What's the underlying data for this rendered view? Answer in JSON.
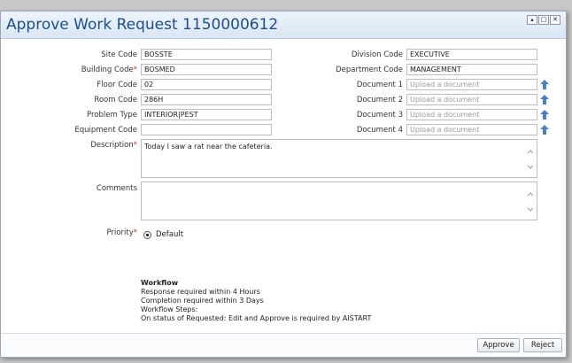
{
  "dialog": {
    "title": "Approve Work Request 1150000612",
    "window_buttons": [
      "▴",
      "□",
      "✕"
    ]
  },
  "fields": {
    "site_code": {
      "label": "Site Code",
      "value": "BOSSTE"
    },
    "building_code": {
      "label": "Building Code",
      "required_mark": "*",
      "value": "BOSMED"
    },
    "floor_code": {
      "label": "Floor Code",
      "value": "02"
    },
    "room_code": {
      "label": "Room Code",
      "value": "286H"
    },
    "problem_type": {
      "label": "Problem Type",
      "value": "INTERIOR|PEST"
    },
    "equipment_code": {
      "label": "Equipment Code",
      "value": ""
    },
    "division_code": {
      "label": "Division Code",
      "value": "EXECUTIVE"
    },
    "department_code": {
      "label": "Department Code",
      "value": "MANAGEMENT"
    },
    "document_1": {
      "label": "Document 1",
      "placeholder": "Upload a document"
    },
    "document_2": {
      "label": "Document 2",
      "placeholder": "Upload a document"
    },
    "document_3": {
      "label": "Document 3",
      "placeholder": "Upload a document"
    },
    "document_4": {
      "label": "Document 4",
      "placeholder": "Upload a document"
    },
    "description": {
      "label": "Description",
      "required_mark": "*",
      "value": "Today I saw a rat near the cafeteria."
    },
    "comments": {
      "label": "Comments",
      "value": ""
    },
    "priority": {
      "label": "Priority",
      "required_mark": "*",
      "option": "Default"
    }
  },
  "workflow": {
    "title": "Workflow",
    "response": "Response required within 4 Hours",
    "completion": "Completion required within 3 Days",
    "steps_label": "Workflow Steps:",
    "step_1": "On status of Requested: Edit and Approve is required by AISTART"
  },
  "footer": {
    "approve_label": "Approve",
    "reject_label": "Reject"
  },
  "colors": {
    "title_text": "#1d4f8c",
    "required": "#c0392b",
    "upload_icon": "#4a7fc1"
  }
}
